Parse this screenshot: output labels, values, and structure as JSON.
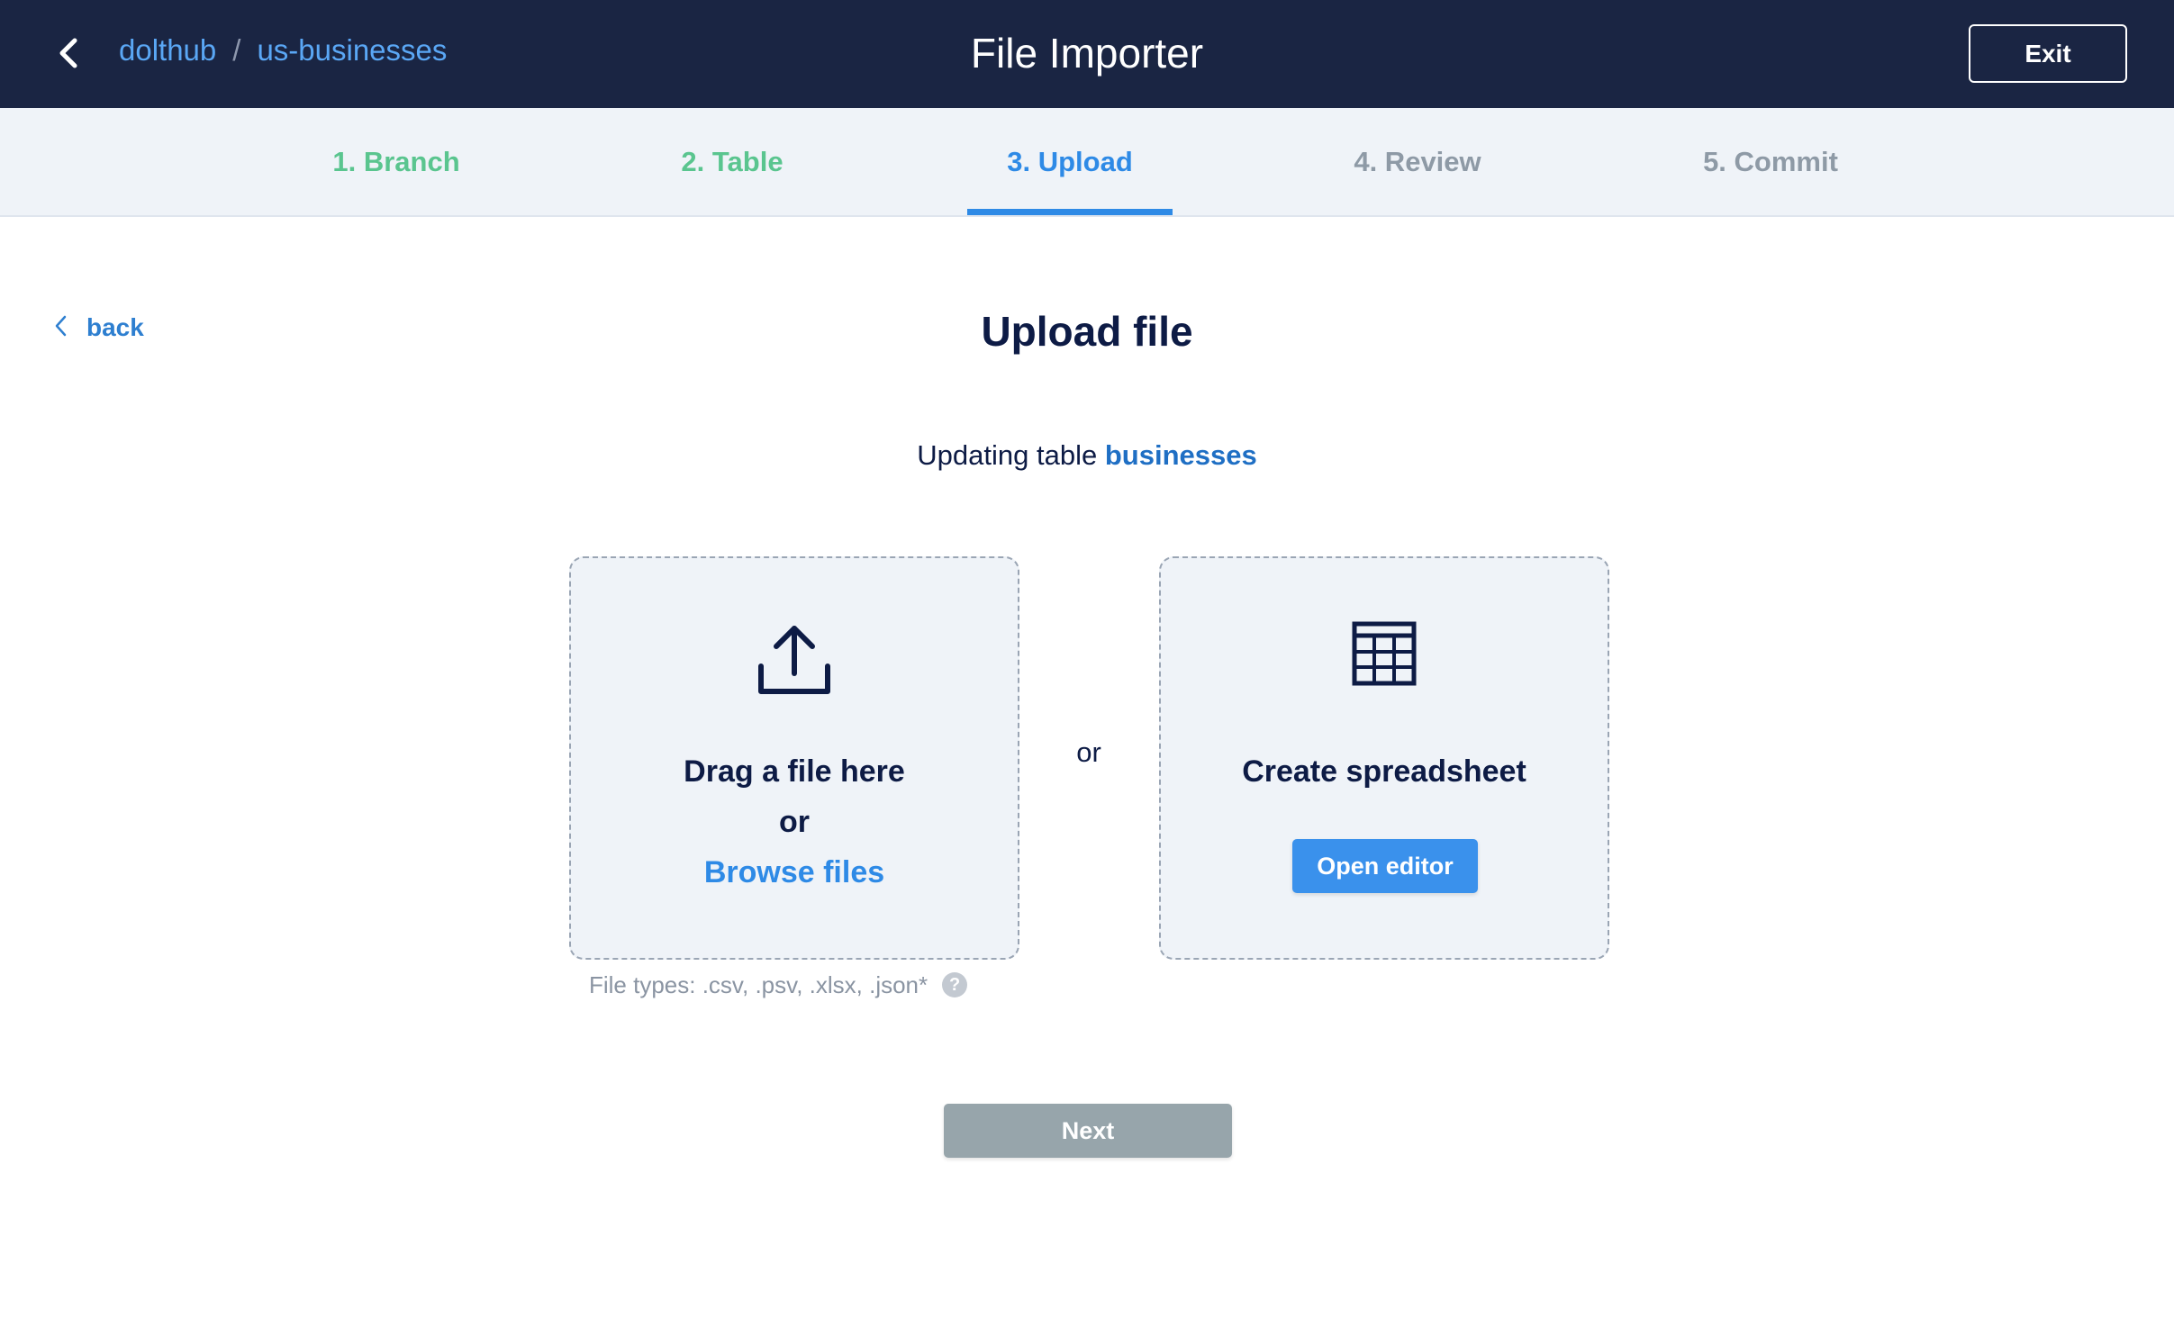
{
  "header": {
    "breadcrumb": {
      "owner": "dolthub",
      "separator": "/",
      "repo": "us-businesses"
    },
    "title": "File Importer",
    "exit_label": "Exit",
    "icons": {
      "back": "chevron-left-icon"
    }
  },
  "steps": [
    {
      "label": "1. Branch",
      "state": "done"
    },
    {
      "label": "2. Table",
      "state": "done"
    },
    {
      "label": "3. Upload",
      "state": "active"
    },
    {
      "label": "4. Review",
      "state": "todo"
    },
    {
      "label": "5. Commit",
      "state": "todo"
    }
  ],
  "main": {
    "back_label": "back",
    "title": "Upload file",
    "updating_prefix": "Updating table",
    "table_name": "businesses",
    "upload_card": {
      "icon": "upload-icon",
      "drag_text": "Drag a file here",
      "or_text": "or",
      "browse_label": "Browse files"
    },
    "separator_text": "or",
    "spreadsheet_card": {
      "icon": "table-grid-icon",
      "title": "Create spreadsheet",
      "button_label": "Open editor"
    },
    "file_types": "File types: .csv, .psv, .xlsx, .json*",
    "help_glyph": "?",
    "next_label": "Next"
  },
  "colors": {
    "header_bg": "#1a2543",
    "accent": "#2e8ae6",
    "step_done": "#5ac58f",
    "step_todo": "#8e9aa6",
    "next_disabled": "#97a5ab"
  }
}
